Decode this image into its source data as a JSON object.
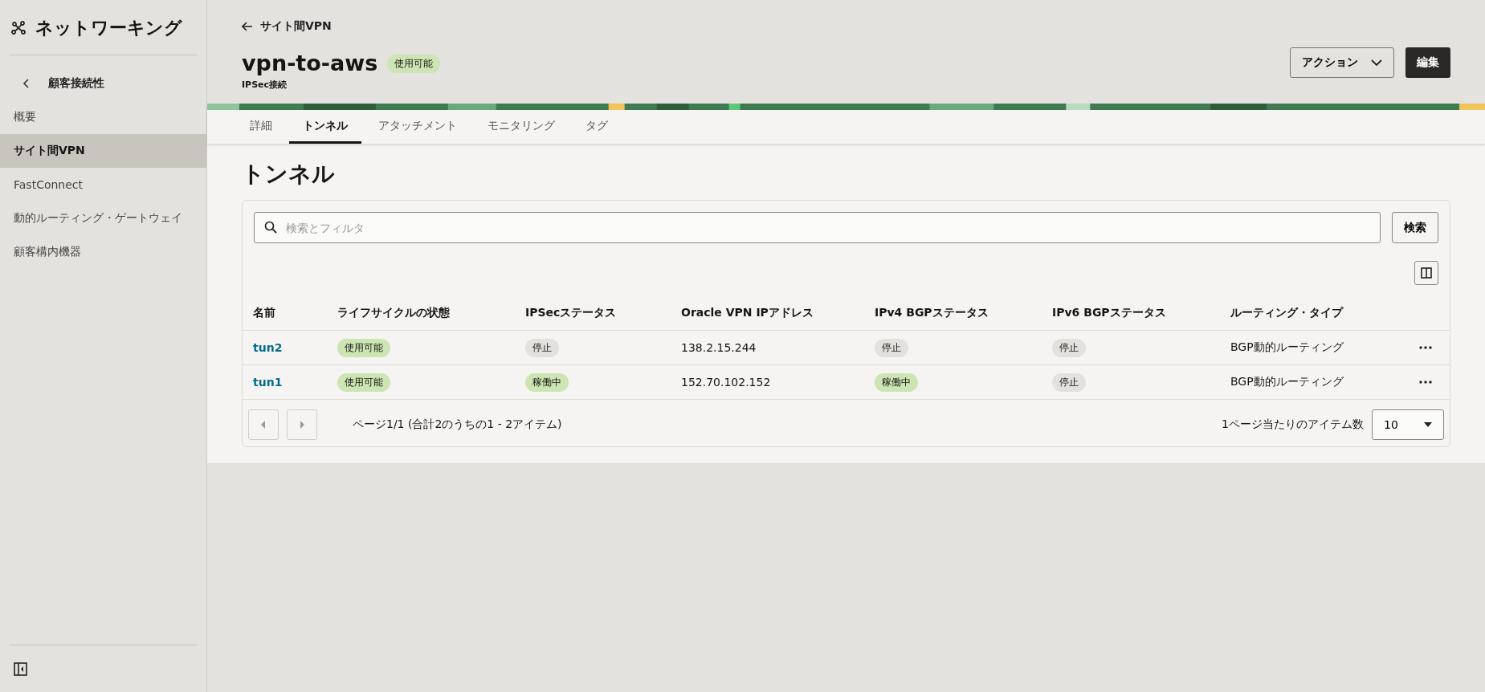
{
  "sidebar": {
    "title": "ネットワーキング",
    "back": "顧客接続性",
    "items": [
      {
        "label": "概要",
        "selected": false
      },
      {
        "label": "サイト間VPN",
        "selected": true
      },
      {
        "label": "FastConnect",
        "selected": false
      },
      {
        "label": "動的ルーティング・ゲートウェイ",
        "selected": false
      },
      {
        "label": "顧客構内機器",
        "selected": false
      }
    ]
  },
  "header": {
    "back_link": "サイト間VPN",
    "title": "vpn-to-aws",
    "status": "使用可能",
    "subtitle": "IPSec接続",
    "actions_button": "アクション",
    "edit_button": "編集"
  },
  "tabs": [
    {
      "label": "詳細",
      "selected": false
    },
    {
      "label": "トンネル",
      "selected": true
    },
    {
      "label": "アタッチメント",
      "selected": false
    },
    {
      "label": "モニタリング",
      "selected": false
    },
    {
      "label": "タグ",
      "selected": false
    }
  ],
  "section_title": "トンネル",
  "search": {
    "placeholder": "検索とフィルタ",
    "button": "検索"
  },
  "table": {
    "columns": [
      "名前",
      "ライフサイクルの状態",
      "IPSecステータス",
      "Oracle VPN IPアドレス",
      "IPv4 BGPステータス",
      "IPv6 BGPステータス",
      "ルーティング・タイプ"
    ],
    "rows": [
      {
        "name": "tun2",
        "lifecycle": {
          "text": "使用可能",
          "kind": "success"
        },
        "ipsec": {
          "text": "停止",
          "kind": "neutral"
        },
        "ip": "138.2.15.244",
        "ipv4_bgp": {
          "text": "停止",
          "kind": "neutral"
        },
        "ipv6_bgp": {
          "text": "停止",
          "kind": "neutral"
        },
        "routing": "BGP動的ルーティング"
      },
      {
        "name": "tun1",
        "lifecycle": {
          "text": "使用可能",
          "kind": "success"
        },
        "ipsec": {
          "text": "稼働中",
          "kind": "success"
        },
        "ip": "152.70.102.152",
        "ipv4_bgp": {
          "text": "稼働中",
          "kind": "success"
        },
        "ipv6_bgp": {
          "text": "停止",
          "kind": "neutral"
        },
        "routing": "BGP動的ルーティング"
      }
    ]
  },
  "pagination": {
    "summary": "ページ1/1 (合計2のうちの1 - 2アイテム)",
    "per_page_label": "1ページ当たりのアイテム数",
    "per_page": "10"
  }
}
